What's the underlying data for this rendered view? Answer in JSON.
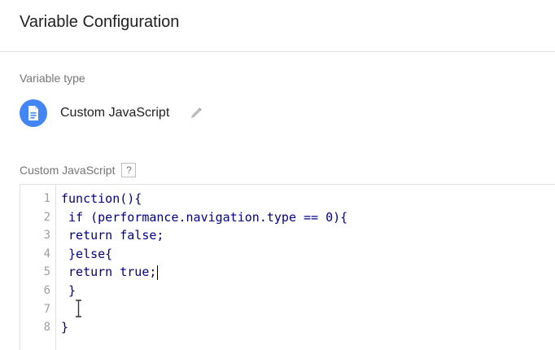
{
  "header": {
    "title": "Variable Configuration"
  },
  "variable_type": {
    "label": "Variable type",
    "name": "Custom JavaScript",
    "icon": "document-icon",
    "icon_color": "#4285f4"
  },
  "code_section": {
    "label": "Custom JavaScript",
    "help": "?"
  },
  "editor": {
    "lines": [
      {
        "num": "1",
        "code": "function(){"
      },
      {
        "num": "2",
        "code": " if (performance.navigation.type == 0){"
      },
      {
        "num": "3",
        "code": " return false;"
      },
      {
        "num": "4",
        "code": " }else{"
      },
      {
        "num": "5",
        "code": " return true;"
      },
      {
        "num": "6",
        "code": " }"
      },
      {
        "num": "7",
        "code": ""
      },
      {
        "num": "8",
        "code": "}"
      }
    ],
    "code_color": "#000080",
    "cursor_line": 5
  }
}
